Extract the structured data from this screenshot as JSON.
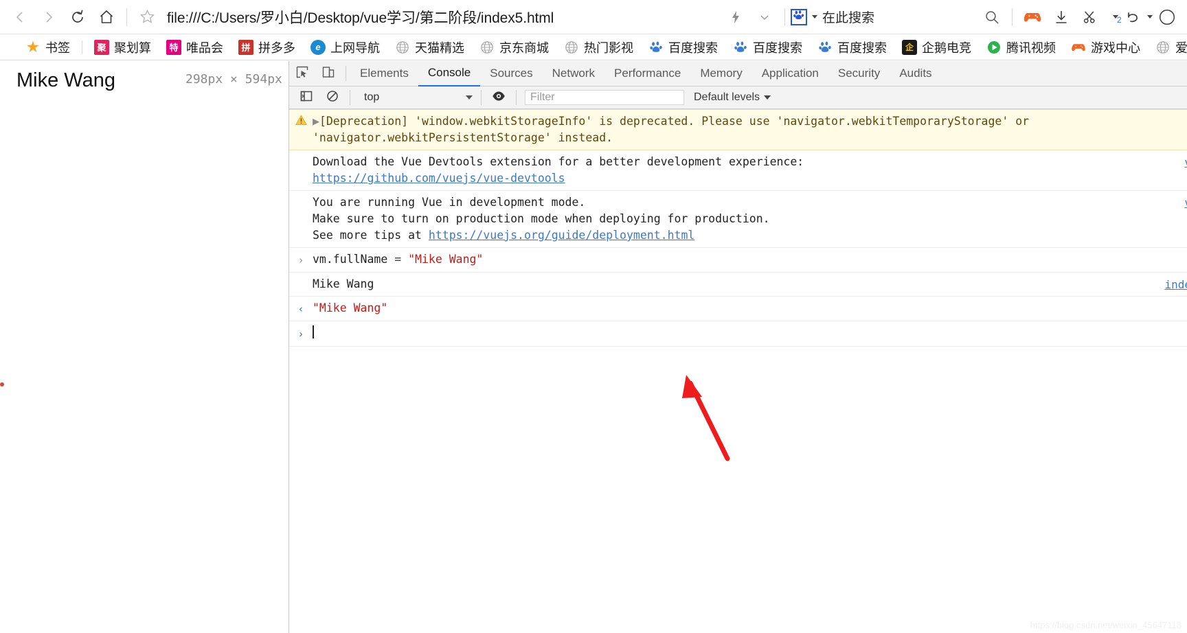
{
  "browser": {
    "nav": {
      "back_icon": "chevron-left-icon",
      "forward_icon": "chevron-right-icon",
      "reload_icon": "reload-icon",
      "home_icon": "home-icon",
      "bookmark_star_icon": "star-outline-icon",
      "url": "file:///C:/Users/罗小白/Desktop/vue学习/第二阶段/index5.html",
      "lightning_icon": "lightning-icon",
      "chevron_down_icon": "chevron-down-icon",
      "engine_icon": "baidu-paw-icon",
      "search_placeholder": "在此搜索",
      "search_icon": "search-icon",
      "game_icon": "gamepad-icon",
      "download_icon": "download-icon",
      "scissors_icon": "scissors-icon",
      "undo_icon": "undo-icon",
      "undo_badge": "2",
      "account_icon": "account-circle-icon"
    },
    "bookmarks": [
      {
        "label": "书签",
        "icon": "star-icon",
        "icon_color": "#f5a623",
        "glyph": "★"
      },
      {
        "label": "聚划算",
        "icon": "juhuasuan-icon",
        "icon_color": "#e0245e",
        "glyph": "聚"
      },
      {
        "label": "唯品会",
        "icon": "vip-icon",
        "icon_color": "#e5007f",
        "glyph": "特"
      },
      {
        "label": "拼多多",
        "icon": "pinduoduo-icon",
        "icon_color": "#c8332c",
        "glyph": "拼"
      },
      {
        "label": "上网导航",
        "icon": "ie-icon",
        "icon_color": "#1a8ad4",
        "glyph": "e"
      },
      {
        "label": "天猫精选",
        "icon": "globe-icon",
        "icon_color": "#9e9e9e",
        "glyph": "◌"
      },
      {
        "label": "京东商城",
        "icon": "globe-icon",
        "icon_color": "#9e9e9e",
        "glyph": "◌"
      },
      {
        "label": "热门影视",
        "icon": "globe-icon",
        "icon_color": "#9e9e9e",
        "glyph": "◌"
      },
      {
        "label": "百度搜索",
        "icon": "baidu-paw-icon",
        "icon_color": "#3a7bd5",
        "glyph": "🐾"
      },
      {
        "label": "百度搜索",
        "icon": "baidu-paw-icon",
        "icon_color": "#3a7bd5",
        "glyph": "🐾"
      },
      {
        "label": "百度搜索",
        "icon": "baidu-paw-icon",
        "icon_color": "#3a7bd5",
        "glyph": "🐾"
      },
      {
        "label": "企鹅电竞",
        "icon": "penguin-esports-icon",
        "icon_color": "#1b1b1b",
        "glyph": "企"
      },
      {
        "label": "腾讯视频",
        "icon": "tencent-video-icon",
        "icon_color": "#2bb24c",
        "glyph": "▶"
      },
      {
        "label": "游戏中心",
        "icon": "gamepad-icon",
        "icon_color": "#f26522",
        "glyph": "🎮"
      },
      {
        "label": "爱淘",
        "icon": "globe-icon",
        "icon_color": "#9e9e9e",
        "glyph": "◌"
      }
    ]
  },
  "page": {
    "heading": "Mike Wang",
    "size_badge": "298px × 594px"
  },
  "devtools": {
    "inspect_icon": "inspect-element-icon",
    "device_icon": "device-toolbar-icon",
    "tabs": [
      {
        "label": "Elements",
        "active": false
      },
      {
        "label": "Console",
        "active": true
      },
      {
        "label": "Sources",
        "active": false
      },
      {
        "label": "Network",
        "active": false
      },
      {
        "label": "Performance",
        "active": false
      },
      {
        "label": "Memory",
        "active": false
      },
      {
        "label": "Application",
        "active": false
      },
      {
        "label": "Security",
        "active": false
      },
      {
        "label": "Audits",
        "active": false
      }
    ],
    "filterbar": {
      "sidebar_icon": "console-sidebar-icon",
      "clear_icon": "clear-console-icon",
      "context_value": "top",
      "eye_icon": "live-expression-eye-icon",
      "filter_placeholder": "Filter",
      "levels_label": "Default levels"
    },
    "console": {
      "messages": [
        {
          "type": "warning",
          "icon": "warning-triangle-icon",
          "expander": "▶",
          "text": "[Deprecation] 'window.webkitStorageInfo' is deprecated. Please use 'navigator.webkitTemporaryStorage' or 'navigator.webkitPersistentStorage' instead.",
          "source": ""
        },
        {
          "type": "log",
          "line1": "Download the Vue Devtools extension for a better development experience:",
          "link": "https://github.com/vuejs/vue-devtools",
          "source": "v"
        },
        {
          "type": "log",
          "line1": "You are running Vue in development mode.",
          "line2": "Make sure to turn on production mode when deploying for production.",
          "line3_prefix": "See more tips at ",
          "link": "https://vuejs.org/guide/deployment.html",
          "source": "v"
        },
        {
          "type": "input",
          "prompt": "›",
          "expr_prefix": "vm.fullName ",
          "expr_op": "= ",
          "expr_value": "\"Mike Wang\""
        },
        {
          "type": "log",
          "line1": "Mike Wang",
          "source": "inde"
        },
        {
          "type": "result",
          "prompt": "‹",
          "value": "\"Mike Wang\""
        }
      ],
      "prompt_caret": "›"
    }
  },
  "watermark": "https://blog.csdn.net/weixin_45647118",
  "colors": {
    "accent": "#1a73e8",
    "warning_bg": "#fffbe5",
    "string": "#c41a16",
    "link": "#3b78c8",
    "annotation_arrow": "#ee1c1c"
  }
}
